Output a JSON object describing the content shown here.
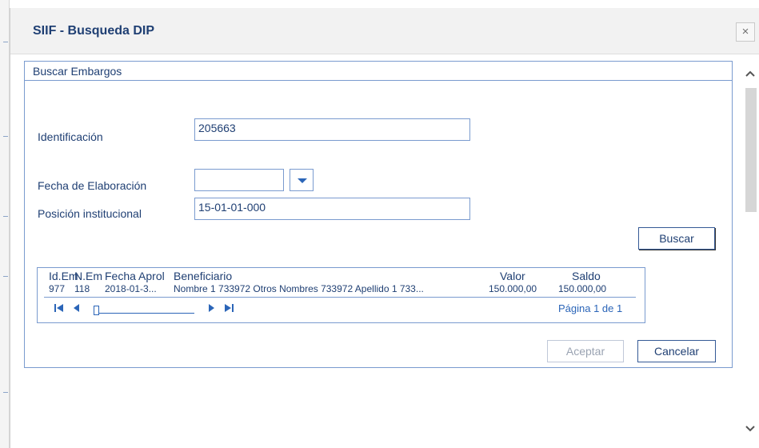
{
  "dialog": {
    "title": "SIIF - Busqueda DIP",
    "close_icon": "close-icon",
    "close_glyph": "×"
  },
  "panel": {
    "title": "Buscar Embargos"
  },
  "form": {
    "identificacion_label": "Identificación",
    "identificacion_value": "205663",
    "fecha_label": "Fecha de Elaboración",
    "fecha_value": "",
    "posicion_label": "Posición institucional",
    "posicion_value": "15-01-01-000",
    "buscar_label": "Buscar"
  },
  "grid": {
    "columns": [
      "Id.Em",
      "N.Em",
      "Fecha Aprol",
      "Beneficiario",
      "Valor",
      "Saldo"
    ],
    "rows": [
      [
        "977",
        "118",
        "2018-01-3...",
        "Nombre 1 733972 Otros Nombres 733972 Apellido 1 733...",
        "150.000,00",
        "150.000,00"
      ]
    ],
    "page_info": "Página 1 de 1",
    "icons": {
      "first": "first-page-icon",
      "prev": "prev-page-icon",
      "next": "next-page-icon",
      "last": "last-page-icon"
    }
  },
  "footer": {
    "aceptar_label": "Aceptar",
    "cancelar_label": "Cancelar"
  },
  "scrollbar": {
    "up_icon": "chevron-up-icon",
    "down_icon": "chevron-down-icon"
  },
  "colors": {
    "border": "#7a9bcf",
    "text": "#1f3f73",
    "accent": "#2b65b8"
  }
}
